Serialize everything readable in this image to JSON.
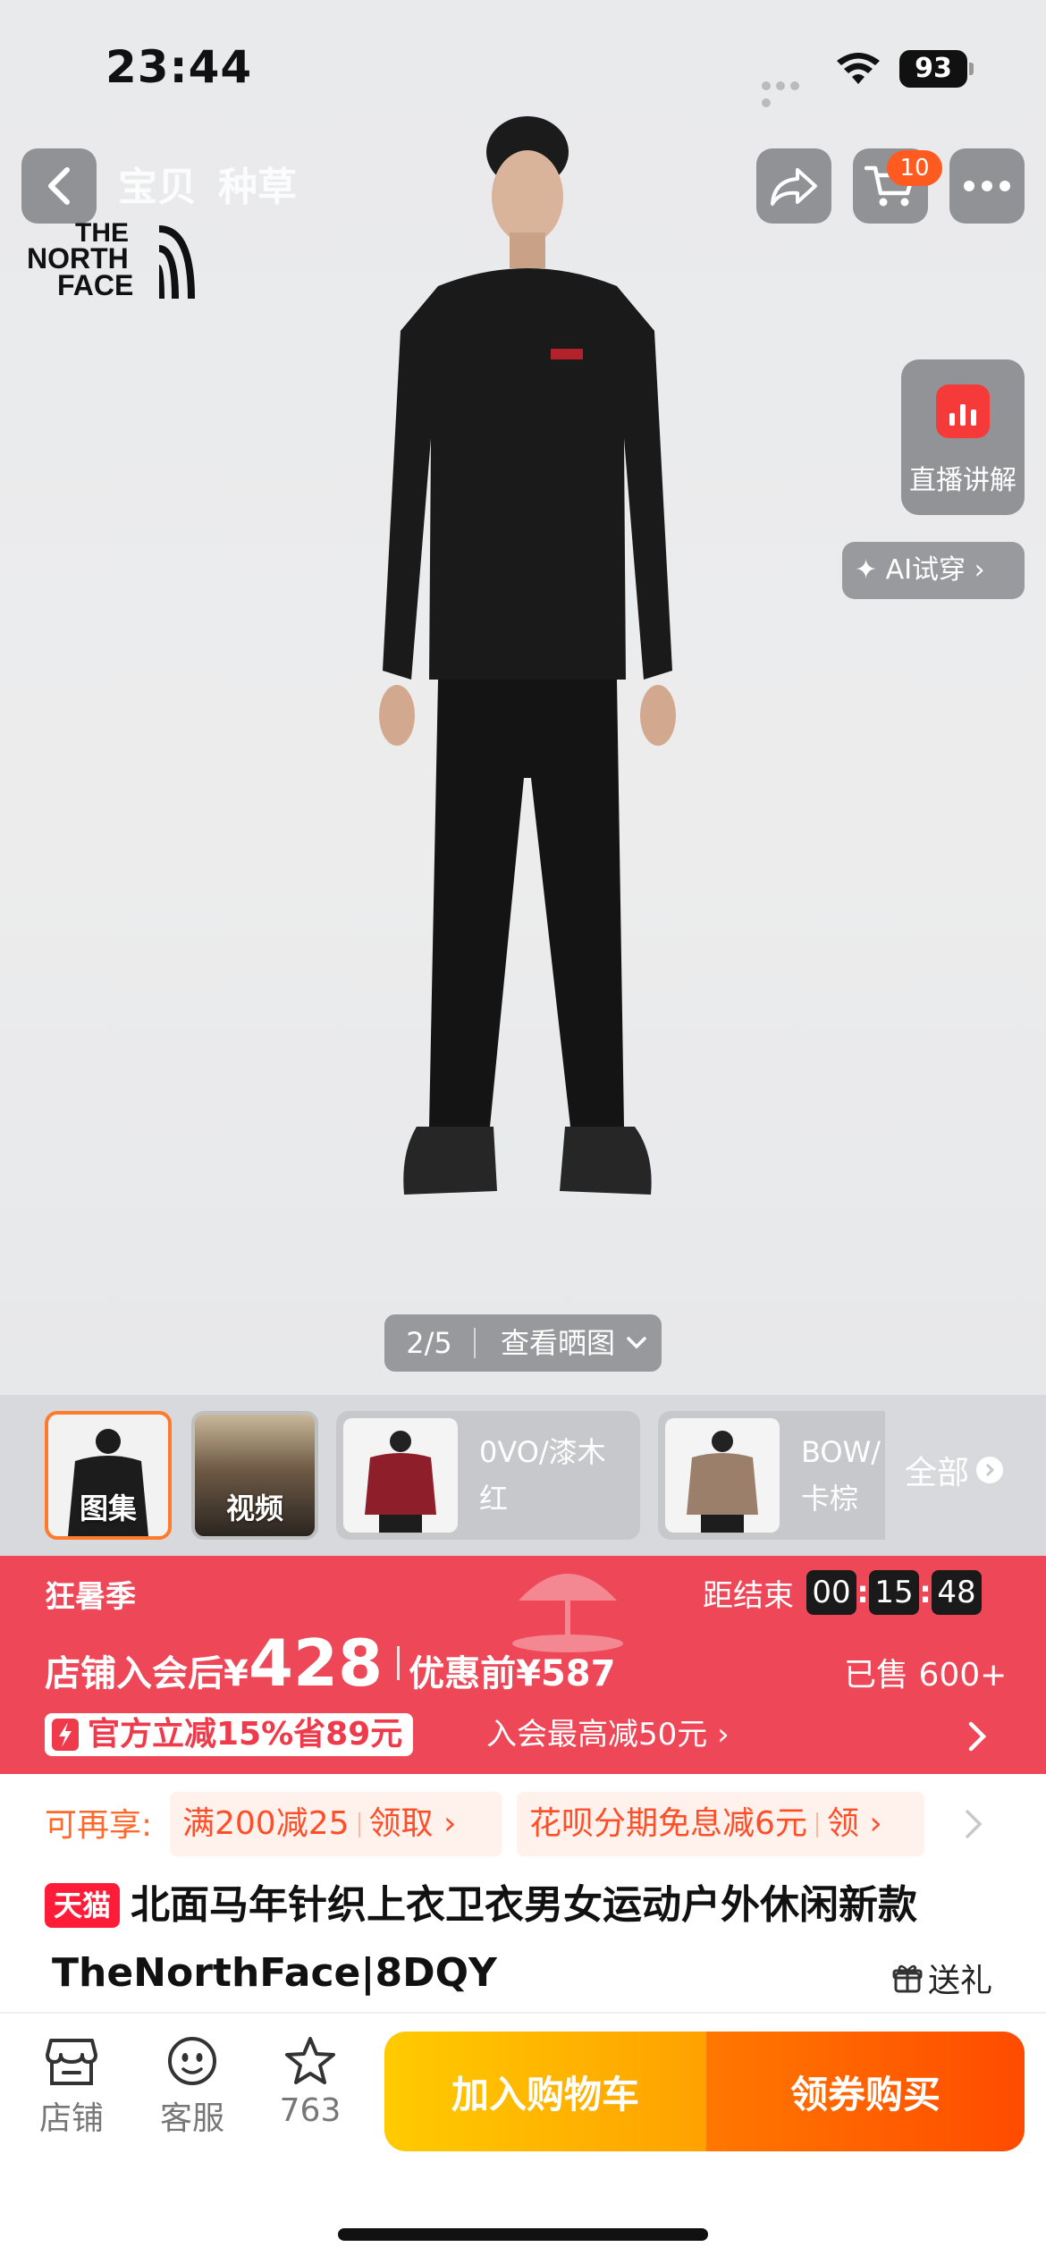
{
  "status_bar": {
    "time": "23:44",
    "battery": "93"
  },
  "nav": {
    "tabs": [
      "宝贝",
      "种草"
    ],
    "cart_badge": "10"
  },
  "brand": {
    "logo_text": [
      "THE",
      "NORTH",
      "FACE"
    ]
  },
  "side": {
    "live_label": "直播讲解",
    "ai_try_label": "✦ AI试穿 ›"
  },
  "pager": {
    "count": "2/5",
    "view_label": "查看晒图"
  },
  "thumbs": {
    "gallery_label": "图集",
    "video_label": "视频",
    "variants": [
      {
        "line1": "0VO/漆木",
        "line2": "红"
      },
      {
        "line1": "BOW/",
        "line2": "卡棕"
      }
    ],
    "all_label": "全部"
  },
  "promo": {
    "season": "狂暑季",
    "countdown_label": "距结束",
    "countdown": [
      "00",
      "15",
      "48"
    ],
    "price_prefix": "店铺入会后¥",
    "price": "428",
    "before_price": "优惠前¥587",
    "sold": "已售 600+",
    "coupon": "官方立减15%省89元",
    "member": "入会最高减50元 ›"
  },
  "offers": {
    "label": "可再享:",
    "chip1_text": "满200减25",
    "chip1_action": "领取 ›",
    "chip2_text": "花呗分期免息减6元",
    "chip2_action": "领 ›"
  },
  "product": {
    "badge": "天猫",
    "title_line1": "北面马年针织上衣卫衣男女运动户外休闲新款",
    "title_line2": "TheNorthFace|8DQY",
    "gift": "送礼"
  },
  "bottom": {
    "store": "店铺",
    "service": "客服",
    "fav_count": "763",
    "add_cart": "加入购物车",
    "buy": "领券购买"
  },
  "colors": {
    "promo_red": "#ee4758",
    "accent_orange": "#ff6a2c",
    "cart_yellow": "#ffb400",
    "buy_orange": "#ff5a00",
    "tmall_red": "#ff1c38"
  }
}
